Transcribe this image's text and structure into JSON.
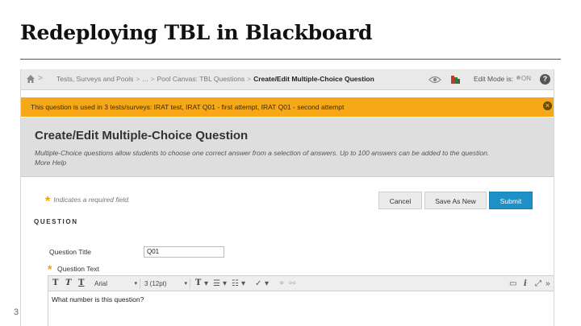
{
  "slide": {
    "title": "Redeploying TBL in Blackboard",
    "page_number": "3"
  },
  "breadcrumb": {
    "items": [
      "Tests, Surveys and Pools",
      "...",
      "Pool Canvas: TBL Questions"
    ],
    "separator": ">",
    "current": "Create/Edit Multiple-Choice Question"
  },
  "topbar": {
    "edit_mode_label": "Edit Mode is:",
    "edit_mode_state": "ON",
    "help_glyph": "?"
  },
  "warning": {
    "text": "This question is used in 3 tests/surveys: IRAT test, IRAT Q01 - first attempt, IRAT Q01 - second attempt",
    "close_glyph": "×",
    "color": "#f7a818"
  },
  "page": {
    "title": "Create/Edit Multiple-Choice Question",
    "description": "Multiple-Choice questions allow students to choose one correct answer from a selection of answers. Up to 100 answers can be added to the question.",
    "more_help": "More Help"
  },
  "form": {
    "required_star": "*",
    "required_note": "Indicates a required field.",
    "cancel_label": "Cancel",
    "save_as_new_label": "Save As New",
    "submit_label": "Submit",
    "section_title": "QUESTION",
    "question_title_label": "Question Title",
    "question_title_value": "Q01",
    "question_text_label": "Question Text",
    "question_text_value": "What number is this question?",
    "accent_color": "#1e8fc7"
  },
  "toolbar": {
    "font_family": "Arial",
    "font_size": "3 (12pt)",
    "dropdown_arrow": "▾",
    "t1": "T",
    "t2": "T",
    "t3": "T",
    "icons": [
      "format-text-icon",
      "list-bulleted-icon",
      "list-numbered-icon",
      "spellcheck-icon",
      "link-icon",
      "unlink-icon",
      "preview-icon",
      "info-icon",
      "fullscreen-icon",
      "collapse-icon"
    ]
  }
}
